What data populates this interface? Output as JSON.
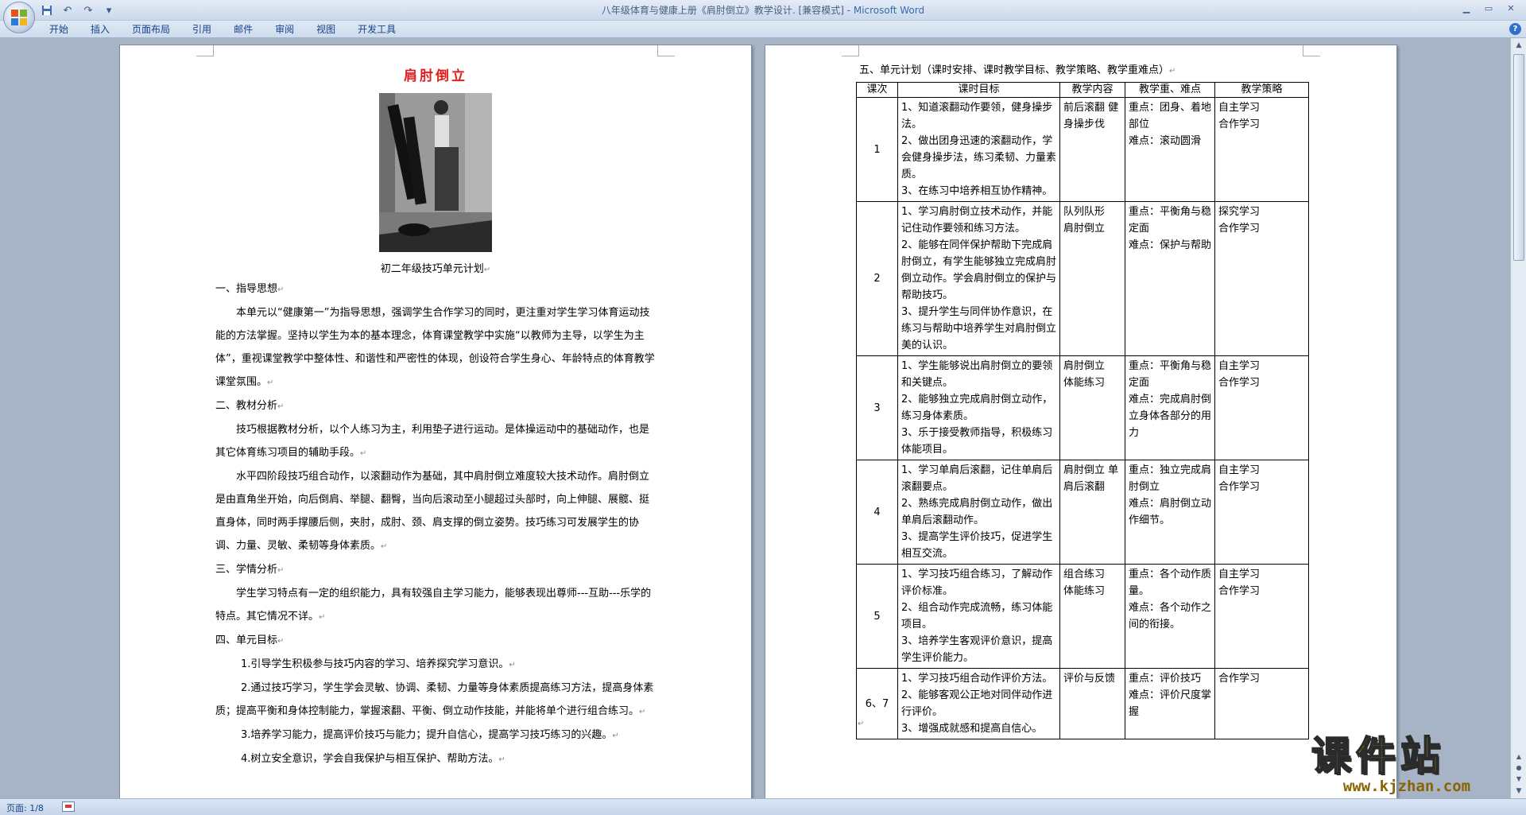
{
  "window": {
    "title": "八年级体育与健康上册《肩肘倒立》教学设计. [兼容模式] - ",
    "app_name": "Microsoft Word"
  },
  "ribbon": {
    "tabs": [
      "开始",
      "插入",
      "页面布局",
      "引用",
      "邮件",
      "审阅",
      "视图",
      "开发工具"
    ]
  },
  "left_page": {
    "title": "肩肘倒立",
    "caption": "初二年级技巧单元计划",
    "paragraphs": [
      {
        "style": "h",
        "text": "一、指导思想"
      },
      {
        "style": "p",
        "text": "本单元以“健康第一”为指导思想，强调学生合作学习的同时，更注重对学生学习体育运动技能的方法掌握。坚持以学生为本的基本理念，体育课堂教学中实施“以教师为主导，以学生为主体”，重视课堂教学中整体性、和谐性和严密性的体现，创设符合学生身心、年龄特点的体育教学课堂氛围。"
      },
      {
        "style": "h",
        "text": "二、教材分析"
      },
      {
        "style": "p",
        "text": "技巧根据教材分析，以个人练习为主，利用垫子进行运动。是体操运动中的基础动作，也是其它体育练习项目的辅助手段。"
      },
      {
        "style": "p",
        "text": "水平四阶段技巧组合动作，以滚翻动作为基础，其中肩肘倒立难度较大技术动作。肩肘倒立是由直角坐开始，向后倒肩、举腿、翻臀，当向后滚动至小腿超过头部时，向上伸腿、展髋、挺直身体，同时两手撑腰后侧，夹肘，成肘、颈、肩支撑的倒立姿势。技巧练习可发展学生的协调、力量、灵敏、柔韧等身体素质。"
      },
      {
        "style": "h",
        "text": "三、学情分析"
      },
      {
        "style": "p",
        "text": "学生学习特点有一定的组织能力，具有较强自主学习能力，能够表现出尊师---互助---乐学的特点。其它情况不详。"
      },
      {
        "style": "h",
        "text": "四、单元目标"
      },
      {
        "style": "li",
        "text": "1.引导学生积极参与技巧内容的学习、培养探究学习意识。"
      },
      {
        "style": "li",
        "text": "2.通过技巧学习，学生学会灵敏、协调、柔韧、力量等身体素质提高练习方法，提高身体素质；提高平衡和身体控制能力，掌握滚翻、平衡、倒立动作技能，并能将单个进行组合练习。"
      },
      {
        "style": "li",
        "text": "3.培养学习能力，提高评价技巧与能力；提升自信心，提高学习技巧练习的兴趣。"
      },
      {
        "style": "li",
        "text": "4.树立安全意识，学会自我保护与相互保护、帮助方法。"
      }
    ]
  },
  "right_page": {
    "plan_title": "五、单元计划（课时安排、课时教学目标、教学策略、教学重难点）",
    "headers": [
      "课次",
      "课时目标",
      "教学内容",
      "教学重、难点",
      "教学策略"
    ],
    "rows": [
      {
        "num": "1",
        "goals": [
          "1、知道滚翻动作要领，健身操步法。",
          "2、做出团身迅速的滚翻动作，学会健身操步法，练习柔韧、力量素质。",
          "3、在练习中培养相互协作精神。"
        ],
        "content": [
          "前后滚翻 健身操步伐"
        ],
        "keypoints": [
          "重点：团身、着地部位",
          "难点：滚动圆滑"
        ],
        "strategy": [
          "自主学习",
          "合作学习"
        ]
      },
      {
        "num": "2",
        "goals": [
          "1、学习肩肘倒立技术动作，并能记住动作要领和练习方法。",
          "2、能够在同伴保护帮助下完成肩肘倒立，有学生能够独立完成肩肘倒立动作。学会肩肘倒立的保护与帮助技巧。",
          "3、提升学生与同伴协作意识，在练习与帮助中培养学生对肩肘倒立美的认识。"
        ],
        "content": [
          "队列队形",
          "肩肘倒立"
        ],
        "keypoints": [
          "重点：平衡角与稳定面",
          "难点：保护与帮助"
        ],
        "strategy": [
          "探究学习",
          "合作学习"
        ]
      },
      {
        "num": "3",
        "goals": [
          "1、学生能够说出肩肘倒立的要领和关键点。",
          "2、能够独立完成肩肘倒立动作，练习身体素质。",
          "3、乐于接受教师指导，积极练习体能项目。"
        ],
        "content": [
          "肩肘倒立",
          "体能练习"
        ],
        "keypoints": [
          "重点：平衡角与稳定面",
          "难点：完成肩肘倒立身体各部分的用力"
        ],
        "strategy": [
          "自主学习",
          "合作学习"
        ]
      },
      {
        "num": "4",
        "goals": [
          "1、学习单肩后滚翻，记住单肩后滚翻要点。",
          "2、熟练完成肩肘倒立动作，做出单肩后滚翻动作。",
          "3、提高学生评价技巧，促进学生相互交流。"
        ],
        "content": [
          "肩肘倒立 单肩后滚翻"
        ],
        "keypoints": [
          "重点：独立完成肩肘倒立",
          "难点：肩肘倒立动作细节。"
        ],
        "strategy": [
          "自主学习",
          "合作学习"
        ]
      },
      {
        "num": "5",
        "goals": [
          "1、学习技巧组合练习，了解动作评价标准。",
          "2、组合动作完成流畅，练习体能项目。",
          "3、培养学生客观评价意识，提高学生评价能力。"
        ],
        "content": [
          "组合练习",
          "体能练习"
        ],
        "keypoints": [
          "重点：各个动作质量。",
          "难点：各个动作之间的衔接。"
        ],
        "strategy": [
          "自主学习",
          "合作学习"
        ]
      },
      {
        "num": "6、7",
        "goals": [
          "1、学习技巧组合动作评价方法。",
          "2、能够客观公正地对同伴动作进行评价。",
          "3、增强成就感和提高自信心。"
        ],
        "content": [
          "评价与反馈"
        ],
        "keypoints": [
          "重点：评价技巧",
          "难点：评价尺度掌握"
        ],
        "strategy": [
          "合作学习"
        ]
      }
    ]
  },
  "status": {
    "page_info": "页面: 1/8"
  },
  "watermark": {
    "text": "课件站",
    "url": "www.kjzhan.com"
  },
  "icons": {
    "office": "office-logo-icon",
    "save": "save-icon",
    "undo": "undo-icon",
    "redo": "redo-icon",
    "help": "help-icon"
  },
  "colors": {
    "title_red": "#e31c1c",
    "ribbon_text": "#15428b",
    "workspace": "#a6b4c6",
    "watermark_yellow": "#f2e600"
  }
}
